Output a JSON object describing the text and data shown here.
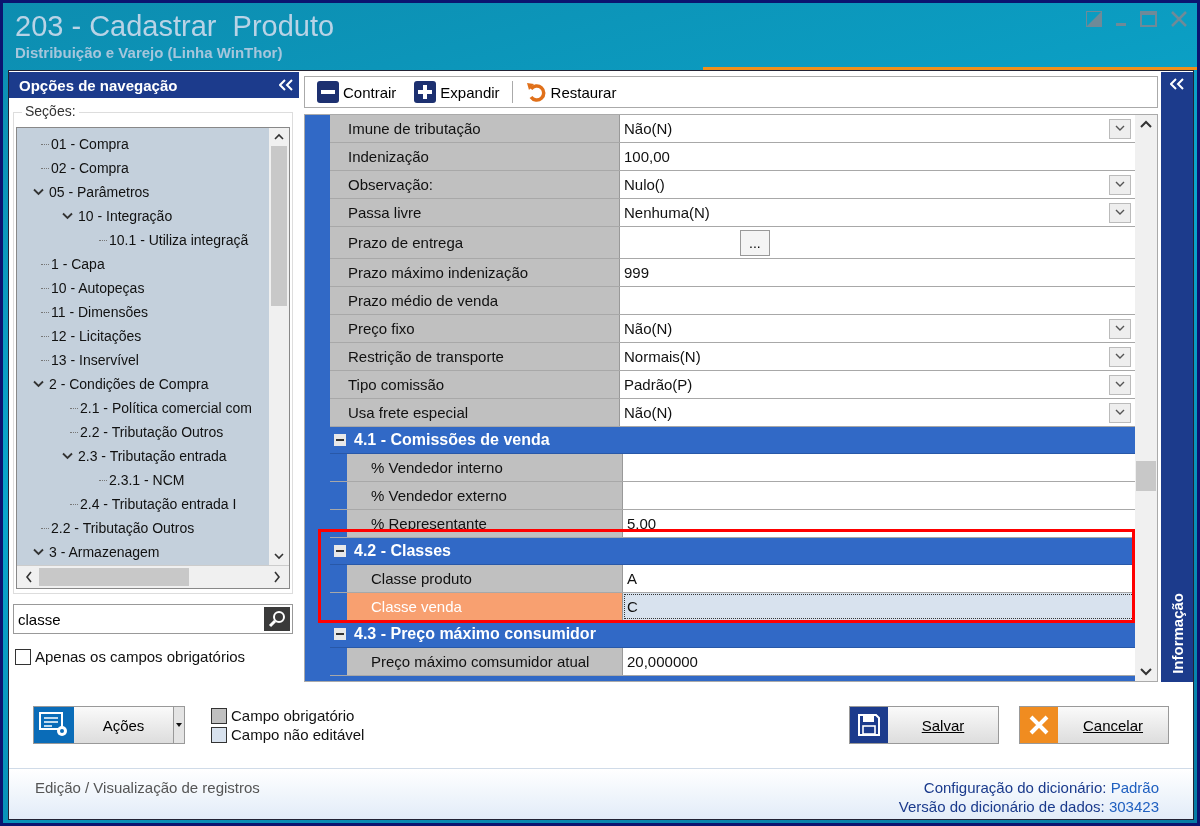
{
  "window": {
    "title": "203 - Cadastrar  Produto",
    "subtitle": "Distribuição e Varejo (Linha WinThor)"
  },
  "navigation": {
    "title": "Opções de navegação",
    "sections_label": "Seções:",
    "tree": [
      {
        "label": "01 - Compra"
      },
      {
        "label": "02 - Compra"
      },
      {
        "label": "05 - Parâmetros",
        "expanded": true,
        "children": [
          {
            "label": "10 - Integração",
            "expanded": true,
            "children": [
              {
                "label": "10.1 - Utiliza integraçã"
              }
            ]
          }
        ]
      },
      {
        "label": "1 - Capa"
      },
      {
        "label": "10 - Autopeças"
      },
      {
        "label": "11 - Dimensões"
      },
      {
        "label": "12 - Licitações"
      },
      {
        "label": "13 - Inservível"
      },
      {
        "label": "2 - Condições de Compra",
        "expanded": true,
        "children": [
          {
            "label": "2.1 - Política comercial com"
          },
          {
            "label": "2.2 - Tributação Outros"
          },
          {
            "label": "2.3 - Tributação entrada",
            "expanded": true,
            "children": [
              {
                "label": "2.3.1 - NCM"
              }
            ]
          },
          {
            "label": "2.4 - Tributação entrada I"
          }
        ]
      },
      {
        "label": "2.2 - Tributação Outros"
      },
      {
        "label": "3 - Armazenagem",
        "expanded": true
      }
    ],
    "search": {
      "value": "classe"
    },
    "required_only": {
      "label": "Apenas os campos obrigatórios",
      "checked": false
    }
  },
  "toolbar": [
    {
      "kind": "collapse",
      "label": "Contrair"
    },
    {
      "kind": "expand",
      "label": "Expandir"
    },
    {
      "kind": "restore",
      "label": "Restaurar"
    }
  ],
  "grid": {
    "rows": [
      {
        "kind": "dropdown",
        "name": "Imune de tributação",
        "value": "Não(N)",
        "selected": false
      },
      {
        "kind": "text",
        "name": "Indenização",
        "value": "100,00",
        "selected": false
      },
      {
        "kind": "dropdown",
        "name": "Observação:",
        "value": "Nulo()",
        "selected": false
      },
      {
        "kind": "dropdown",
        "name": "Passa livre",
        "value": "Nenhuma(N)",
        "selected": false
      },
      {
        "kind": "ellipsis",
        "name": "Prazo de entrega",
        "button": "...",
        "selected": false
      },
      {
        "kind": "text",
        "name": "Prazo máximo indenização",
        "value": "999",
        "selected": false
      },
      {
        "kind": "text",
        "name": "Prazo médio de venda",
        "selected": false
      },
      {
        "kind": "dropdown",
        "name": "Preço fixo",
        "value": "Não(N)",
        "selected": false
      },
      {
        "kind": "dropdown",
        "name": "Restrição de transporte",
        "value": "Normais(N)",
        "selected": false
      },
      {
        "kind": "dropdown",
        "name": "Tipo comissão",
        "value": "Padrão(P)",
        "selected": false
      },
      {
        "kind": "dropdown",
        "name": "Usa frete especial",
        "value": "Não(N)",
        "selected": false
      }
    ],
    "groups": [
      {
        "title": "4.1 - Comissões de venda",
        "expanded": true,
        "highlighted": false,
        "rows": [
          {
            "kind": "text",
            "name": "% Vendedor interno",
            "selected": false
          },
          {
            "kind": "text",
            "name": "% Vendedor externo",
            "selected": false
          },
          {
            "kind": "text",
            "name": "% Representante",
            "value": "5,00",
            "selected": false
          }
        ]
      },
      {
        "title": "4.2 - Classes",
        "expanded": true,
        "highlighted": true,
        "rows": [
          {
            "kind": "text",
            "name": "Classe produto",
            "value": "A",
            "selected": false
          },
          {
            "kind": "text",
            "name": "Classe venda",
            "value": "C",
            "selected": true
          }
        ]
      },
      {
        "title": "4.3 - Preço máximo consumidor",
        "expanded": true,
        "highlighted": false,
        "rows": [
          {
            "kind": "text",
            "name": "Preço máximo comsumidor atual",
            "value": "20,000000",
            "selected": false
          }
        ]
      }
    ]
  },
  "info_panel": {
    "title": "Informação"
  },
  "actions": {
    "label": "Ações"
  },
  "legend": [
    {
      "label": "Campo obrigatório",
      "color": "#c0c0c0"
    },
    {
      "label": "Campo não editável",
      "color": "#d8e2ee"
    }
  ],
  "buttons": [
    {
      "kind": "save",
      "label": "Salvar"
    },
    {
      "kind": "cancel",
      "label": "Cancelar"
    }
  ],
  "status_bar": {
    "mode": "Edição / Visualização de registros",
    "info": [
      {
        "label": "Configuração do dicionário:",
        "value": "Padrão"
      },
      {
        "label": "Versão do dicionário de dados:",
        "value": "303423"
      }
    ]
  }
}
